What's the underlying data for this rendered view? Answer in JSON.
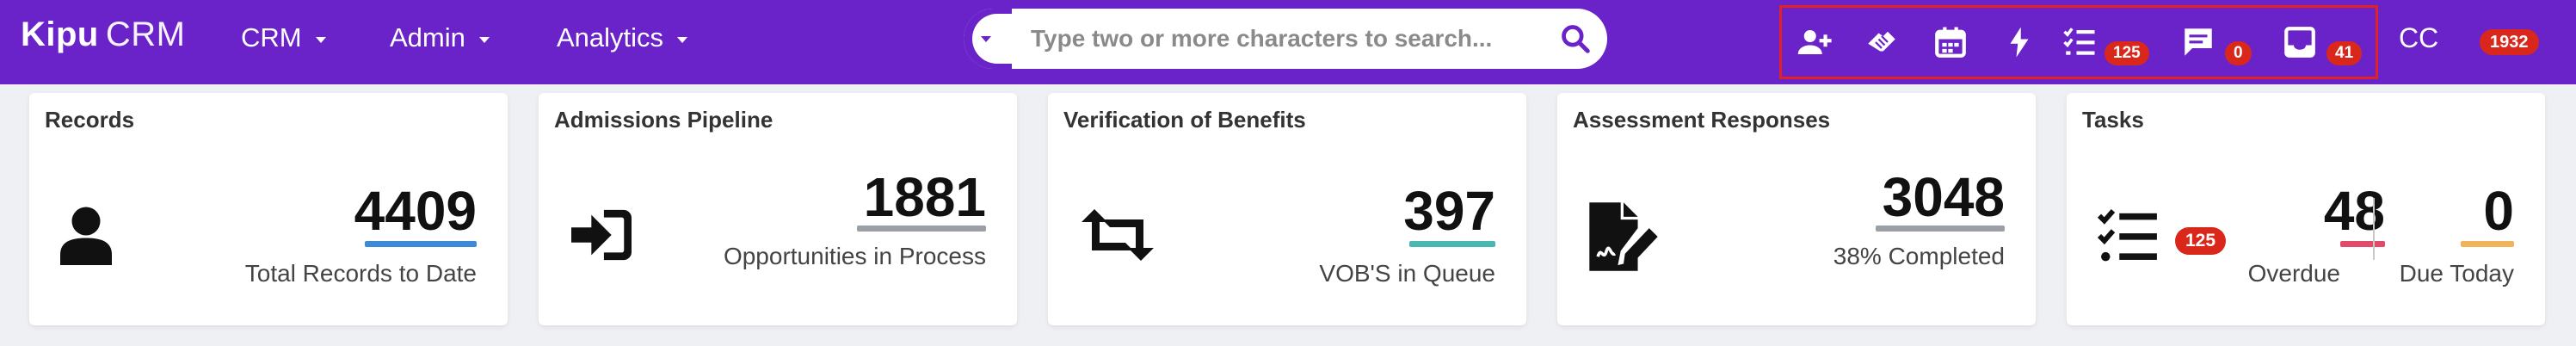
{
  "brand": {
    "name": "Kipu",
    "product": "CRM"
  },
  "nav": [
    {
      "label": "CRM"
    },
    {
      "label": "Admin"
    },
    {
      "label": "Analytics"
    }
  ],
  "search": {
    "placeholder": "Type two or more characters to search..."
  },
  "toolbar": {
    "icons": [
      "add-user-icon",
      "handshake-icon",
      "calendar-icon",
      "lightning-icon",
      "task-list-icon",
      "message-icon",
      "inbox-icon"
    ],
    "tasks_badge": "125",
    "messages_badge": "0",
    "inbox_badge": "41"
  },
  "user": {
    "initials": "CC",
    "badge": "1932"
  },
  "cards": {
    "records": {
      "title": "Records",
      "value": "4409",
      "label": "Total Records to Date"
    },
    "admissions": {
      "title": "Admissions Pipeline",
      "value": "1881",
      "label": "Opportunities in Process"
    },
    "vob": {
      "title": "Verification of Benefits",
      "value": "397",
      "label": "VOB'S in Queue"
    },
    "assessment": {
      "title": "Assessment Responses",
      "value": "3048",
      "label": "38% Completed"
    },
    "tasks": {
      "title": "Tasks",
      "badge": "125",
      "overdue_value": "48",
      "overdue_label": "Overdue",
      "due_value": "0",
      "due_label": "Due Today"
    }
  },
  "colors": {
    "topbar": "#6a22c9",
    "badge": "#d9281b",
    "records_underline": "#3d8bd8",
    "admissions_underline": "#9aa0a6",
    "vob_underline": "#4ab8b0",
    "assessment_underline": "#9aa0a6",
    "overdue_underline": "#e24a6a",
    "due_underline": "#f0b25a"
  }
}
